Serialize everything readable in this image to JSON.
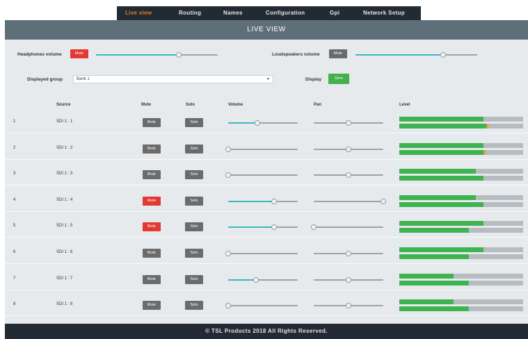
{
  "nav": {
    "items": [
      {
        "label": "Live view",
        "active": true
      },
      {
        "label": "Routing",
        "active": false
      },
      {
        "label": "Names",
        "active": false
      },
      {
        "label": "Configuration",
        "active": false
      },
      {
        "label": "Gpi",
        "active": false
      },
      {
        "label": "Network Setup",
        "active": false
      }
    ]
  },
  "title": "LIVE VIEW",
  "controls": {
    "headphones_label": "Headphones volume",
    "headphones_mute": "Mute",
    "headphones_volume": 0.68,
    "loudspeakers_label": "Loudspeakers volume",
    "loudspeakers_mute": "Mute",
    "loudspeakers_volume": 0.72,
    "group_label": "Displayed group",
    "group_value": "Bank 1",
    "display_label": "Display",
    "display_button": "Dem"
  },
  "table": {
    "headers": {
      "source": "Source",
      "mute": "Mute",
      "solo": "Solo",
      "volume": "Volume",
      "pan": "Pan",
      "level": "Level"
    },
    "rows": [
      {
        "num": "1",
        "source": "SDI 1 : 1",
        "mute_label": "Mute",
        "mute_on": false,
        "solo_label": "Solo",
        "volume": 0.42,
        "pan": 0.5,
        "level_a": 0.68,
        "level_b": 0.7,
        "peak_b": true
      },
      {
        "num": "2",
        "source": "SDI 1 : 2",
        "mute_label": "Mute",
        "mute_on": false,
        "solo_label": "Solo",
        "volume": 0.0,
        "pan": 0.5,
        "level_a": 0.68,
        "level_b": 0.68,
        "peak_b": true
      },
      {
        "num": "3",
        "source": "SDI 1 : 3",
        "mute_label": "Mute",
        "mute_on": false,
        "solo_label": "Solo",
        "volume": 0.0,
        "pan": 0.5,
        "level_a": 0.62,
        "level_b": 0.68,
        "peak_b": false
      },
      {
        "num": "4",
        "source": "SDI 1 : 4",
        "mute_label": "Mute",
        "mute_on": true,
        "solo_label": "Solo",
        "volume": 0.66,
        "pan": 1.0,
        "level_a": 0.62,
        "level_b": 0.68,
        "peak_b": false
      },
      {
        "num": "5",
        "source": "SDI 1 : 5",
        "mute_label": "Mute",
        "mute_on": true,
        "solo_label": "Solo",
        "volume": 0.66,
        "pan": 0.0,
        "level_a": 0.68,
        "level_b": 0.56,
        "peak_b": false
      },
      {
        "num": "6",
        "source": "SDI 1 : 6",
        "mute_label": "Mute",
        "mute_on": false,
        "solo_label": "Solo",
        "volume": 0.0,
        "pan": 0.5,
        "level_a": 0.68,
        "level_b": 0.56,
        "peak_b": false
      },
      {
        "num": "7",
        "source": "SDI 1 : 7",
        "mute_label": "Mute",
        "mute_on": false,
        "solo_label": "Solo",
        "volume": 0.4,
        "pan": 0.5,
        "level_a": 0.44,
        "level_b": 0.56,
        "peak_b": false
      },
      {
        "num": "8",
        "source": "SDI 1 : 8",
        "mute_label": "Mute",
        "mute_on": false,
        "solo_label": "Solo",
        "volume": 0.0,
        "pan": 0.5,
        "level_a": 0.44,
        "level_b": 0.56,
        "peak_b": false
      }
    ]
  },
  "footer": "© TSL Products 2018 All Rights Reserved.",
  "colors": {
    "accent_orange": "#e9772a",
    "mute_red": "#e03a32",
    "display_green": "#43b04a",
    "level_green": "#3fb34f",
    "slider_teal": "#3bb7c4",
    "nav_dark": "#222a33"
  }
}
